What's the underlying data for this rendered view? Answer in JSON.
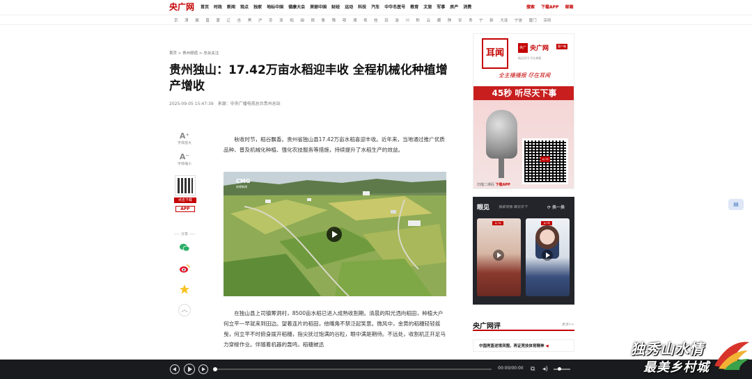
{
  "header": {
    "logo_text": "央广网",
    "nav": [
      "首页",
      "时政",
      "新闻",
      "观点",
      "独家",
      "地标中国",
      "德康大会",
      "美丽中国",
      "财经",
      "运动",
      "科技",
      "汽车",
      "中华名医号",
      "教育",
      "文旅",
      "军事",
      "房产",
      "消费"
    ],
    "search_label": "搜索",
    "download_label": "下载APP",
    "mail_label": "邮箱"
  },
  "subnav": [
    "京",
    "津",
    "冀",
    "晋",
    "蒙",
    "辽",
    "吉",
    "黑",
    "沪",
    "苏",
    "浙",
    "皖",
    "闽",
    "赣",
    "鲁",
    "豫",
    "鄂",
    "湘",
    "粤",
    "桂",
    "琼",
    "渝",
    "川",
    "黔",
    "云",
    "藏",
    "陕",
    "甘",
    "青",
    "宁",
    "新",
    "大连",
    "宁波",
    "厦门",
    "深圳"
  ],
  "article": {
    "breadcrumb": "首页 > 贵州频道 > 总台关注",
    "title": "贵州独山：17.42万亩水稻迎丰收 全程机械化种植增产增收",
    "date": "2025-09-05 15:47:39",
    "source": "来源：中央广播电视总台贵州总站",
    "paragraph1": "秋收时节，稻谷飘香。贵州省独山县17.42万亩水稻喜迎丰收。近年来，当地通过推广优质品种、普及机械化种植、强化农技服务等措施，持续提升了水稻生产的效益。",
    "paragraph2": "在独山县上司镇筹洞村，8500亩水稻已进入成熟收割期。清晨的阳光洒向稻田，种植大户何立平一早就来到田边。望着连片的稻田，他嘴角不禁泛起笑意。微风中，金黄的稻穗轻轻摇曳，何立平不时俯身拨开稻穗，指尖抚过饱满的谷粒，眼中满是期待。不远处，收割机正开足马力穿梭作业。伴随着机器的轰鸣，稻穗被迅",
    "video_logo": "CMG",
    "video_logo_sub": "央视新闻"
  },
  "tools": {
    "font_up_glyph": "A⁺",
    "font_up": "字体放大",
    "font_down_glyph": "A⁻",
    "font_down": "字体缩小",
    "qr_button": "点击下载",
    "app_badge": "APP",
    "share_label": "分享",
    "up_glyph": "︿"
  },
  "ad": {
    "logo": "耳闻",
    "brand_badge": "央广网",
    "brand_name": "央广网",
    "brand_tag": "客户端",
    "brand_slogan": "精品资讯 尽在掌握",
    "slogan": "全主播播报 尽在耳闻",
    "band": "45秒 听尽天下事",
    "qr_tag": "央广网",
    "scan_text": "扫描二维码",
    "scan_action": "下载APP"
  },
  "yanjian": {
    "title": "眼见",
    "subtitle": "独家视角 眼见天下",
    "refresh": "换一换",
    "card_tag": "央广网"
  },
  "comment": {
    "title": "央广网评",
    "more": "更多>>",
    "item": "中国男篮逆境突围，再证竞技体育精神"
  },
  "side_tab": "▤",
  "player": {
    "time": "00:00/00:00"
  },
  "watermark": {
    "line1": "独秀山水情",
    "line2": "最美乡村城"
  }
}
